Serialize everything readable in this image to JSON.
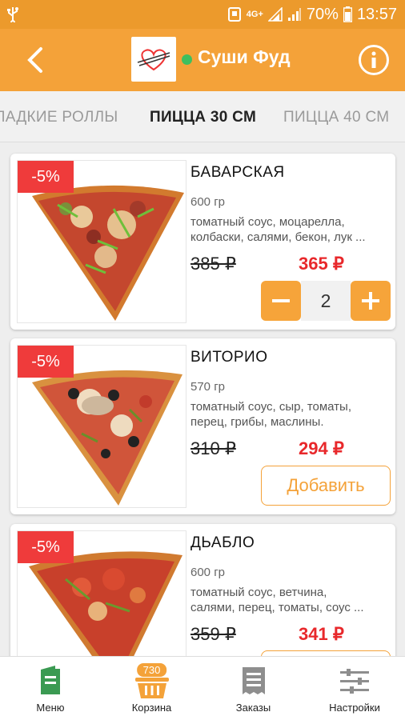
{
  "status_bar": {
    "network": "4G+",
    "battery": "70%",
    "time": "13:57"
  },
  "app_bar": {
    "title": "Суши Фуд",
    "back_icon": "chevron-left-icon",
    "info_icon": "info-icon",
    "online_color": "#3fbf5f"
  },
  "tabs": [
    {
      "label": "ЛАДКИЕ РОЛЛЫ",
      "active": false
    },
    {
      "label": "ПИЦЦА 30 СМ",
      "active": true
    },
    {
      "label": "ПИЦЦА 40 СМ",
      "active": false
    }
  ],
  "products": [
    {
      "discount": "-5%",
      "name": "БАВАРСКАЯ",
      "weight": "600 гр",
      "ingredients": "томатный соус, моцарелла,\nколбаски, салями, бекон, лук ...",
      "old_price": "385 ₽",
      "new_price": "365 ₽",
      "quantity": "2"
    },
    {
      "discount": "-5%",
      "name": "ВИТОРИО",
      "weight": "570 гр",
      "ingredients": "томатный соус, сыр, томаты,\nперец, грибы, маслины.",
      "old_price": "310 ₽",
      "new_price": "294 ₽",
      "add_label": "Добавить"
    },
    {
      "discount": "-5%",
      "name": "ДЬАБЛО",
      "weight": "600 гр",
      "ingredients": "томатный соус, ветчина,\nсалями, перец, томаты, соус ...",
      "old_price": "359 ₽",
      "new_price": "341 ₽"
    }
  ],
  "bottom_nav": {
    "items": [
      {
        "label": "Меню",
        "icon": "menu-book-icon"
      },
      {
        "label": "Корзина",
        "icon": "basket-icon",
        "badge": "730"
      },
      {
        "label": "Заказы",
        "icon": "receipt-icon"
      },
      {
        "label": "Настройки",
        "icon": "sliders-icon"
      }
    ]
  },
  "colors": {
    "accent": "#f4a239",
    "status_bar": "#ec9a2c",
    "discount": "#ef3b3b",
    "new_price": "#e8282b",
    "menu_icon": "#3a9a52"
  }
}
